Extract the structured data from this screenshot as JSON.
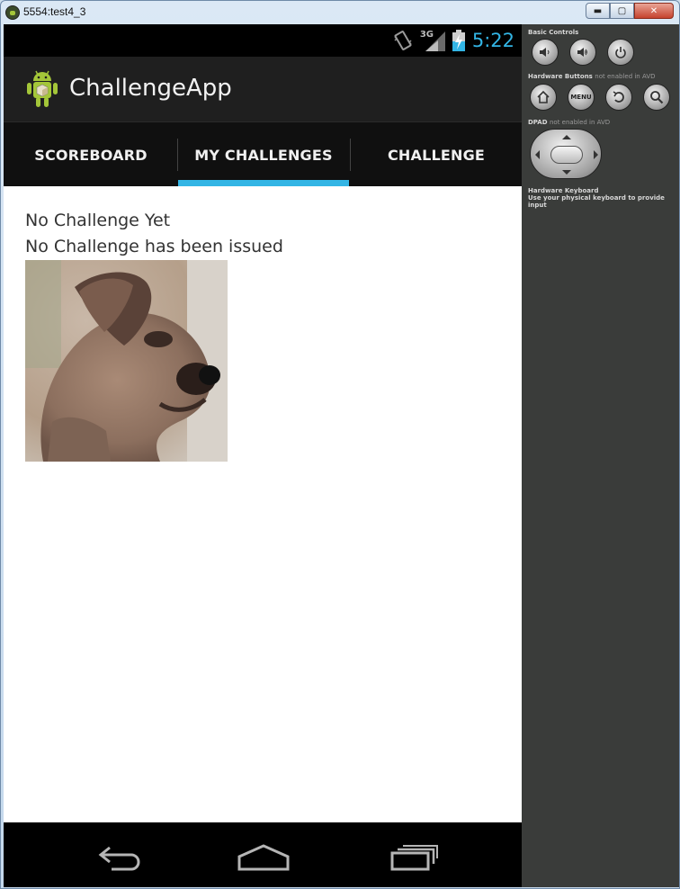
{
  "window": {
    "title": "5554:test4_3",
    "minimize_label": "▬",
    "maximize_label": "▢",
    "close_label": "✕"
  },
  "statusbar": {
    "network": "3G",
    "clock": "5:22"
  },
  "actionbar": {
    "app_title": "ChallengeApp"
  },
  "tabs": [
    {
      "label": "SCOREBOARD",
      "selected": false
    },
    {
      "label": "MY CHALLENGES",
      "selected": true
    },
    {
      "label": "CHALLENGE",
      "selected": false
    }
  ],
  "accent_color": "#33b5e5",
  "content": {
    "heading": "No Challenge Yet",
    "message": "No Challenge has been issued",
    "image": "terrier-puppy-photo"
  },
  "navbar": {
    "back": "back-icon",
    "home": "home-icon",
    "recents": "recents-icon"
  },
  "panel": {
    "basic_controls": "Basic Controls",
    "hardware_buttons": "Hardware Buttons",
    "hardware_buttons_note": "not enabled in AVD",
    "dpad": "DPAD",
    "dpad_note": "not enabled in AVD",
    "keyboard_title": "Hardware Keyboard",
    "keyboard_note": "Use your physical keyboard to provide input",
    "menu_label": "MENU"
  }
}
